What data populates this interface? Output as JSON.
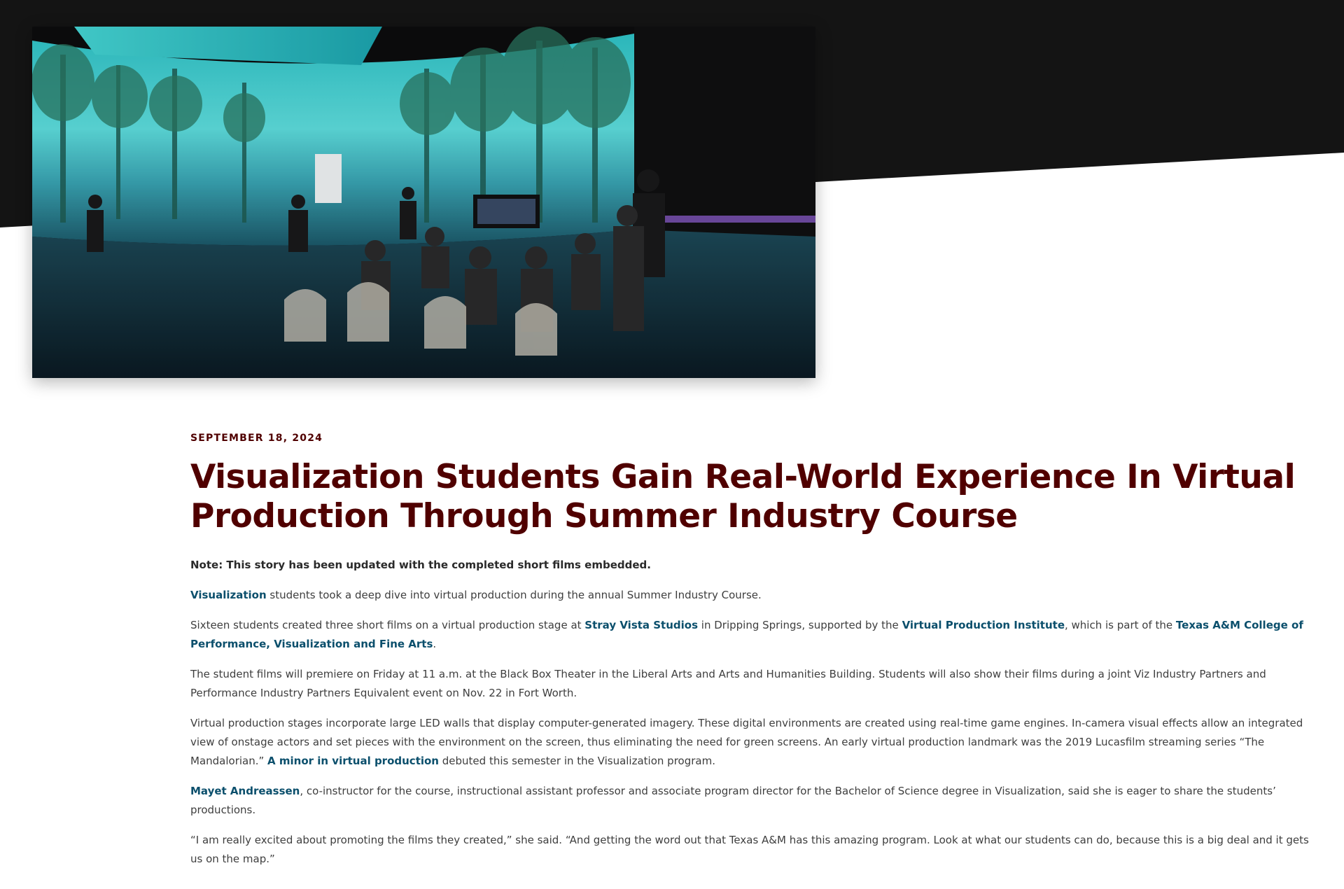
{
  "article": {
    "date": "SEPTEMBER 18, 2024",
    "headline": "Visualization Students Gain Real-World Experience In Virtual Production Through Summer Industry Course",
    "note": "Note: This story has been updated with the completed short films embedded.",
    "p1": {
      "link_visualization": "Visualization",
      "text_after": " students took a deep dive into virtual production during the annual Summer Industry Course."
    },
    "p2": {
      "text_a": "Sixteen students created three short films on a virtual production stage at ",
      "link_stray_vista": "Stray Vista Studios",
      "text_b": " in Dripping Springs, supported by the ",
      "link_vpi": "Virtual Production Institute",
      "text_c": ", which is part of the ",
      "link_college": "Texas A&M College of Performance, Visualization and Fine Arts",
      "text_d": "."
    },
    "p3": "The student films will premiere on Friday at 11 a.m. at the Black Box Theater in the Liberal Arts and Arts and Humanities Building. Students will also show their films during a joint Viz Industry Partners and Performance Industry Partners Equivalent event on Nov. 22 in Fort Worth.",
    "p4": {
      "text_a": "Virtual production stages incorporate large LED walls that display computer-generated imagery. These digital environments are created using real-time game engines. In-camera visual effects allow an integrated view of onstage actors and set pieces with the environment on the screen, thus eliminating the need for green screens. An early virtual production landmark was the 2019 Lucasfilm streaming series “The Mandalorian.” ",
      "link_minor": "A minor in virtual production",
      "text_b": " debuted this semester in the Visualization program."
    },
    "p5": {
      "link_mayet": "Mayet Andreassen",
      "text_after": ", co-instructor for the course, instructional assistant professor and associate program director for the Bachelor of Science degree in Visualization, said she is eager to share the students’ productions."
    },
    "p6": "“I am really excited about promoting the films they created,” she said. “And getting the word out that Texas A&M has this amazing program. Look at what our students can do, because this is a big deal and it gets us on the map.”"
  },
  "colors": {
    "maroon": "#500000",
    "link_blue": "#0b4f6c",
    "hero_dark": "#141414",
    "body_text": "#3e3e3e"
  }
}
